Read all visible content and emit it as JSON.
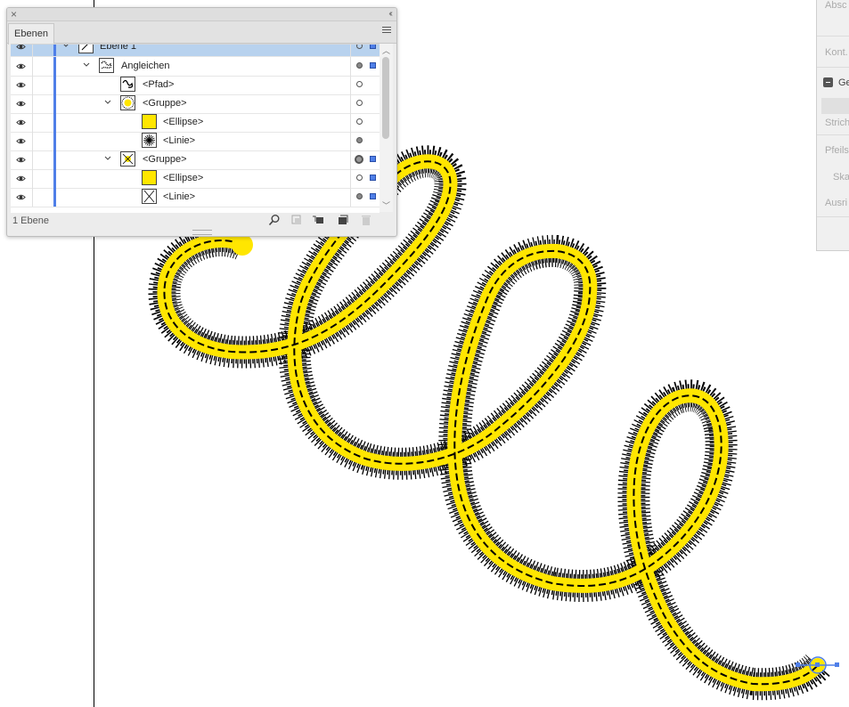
{
  "layers_panel": {
    "tab_label": "Ebenen",
    "status_text": "1 Ebene",
    "rows": [
      {
        "label": "Ebene 1"
      },
      {
        "label": "Angleichen"
      },
      {
        "label": "<Pfad>"
      },
      {
        "label": "<Gruppe>"
      },
      {
        "label": "<Ellipse>"
      },
      {
        "label": "<Linie>"
      },
      {
        "label": "<Gruppe>"
      },
      {
        "label": "<Ellipse>"
      },
      {
        "label": "<Linie>"
      }
    ]
  },
  "right_panel": {
    "labels": [
      "Absc",
      "Kont.",
      "Ge",
      "Strich",
      "Pfeilsp",
      "Skal",
      "Ausri"
    ]
  },
  "colors": {
    "blend_yellow": "#ffe600",
    "selection_blue": "#4f7fe8",
    "row_selected": "#b8d2ee"
  }
}
